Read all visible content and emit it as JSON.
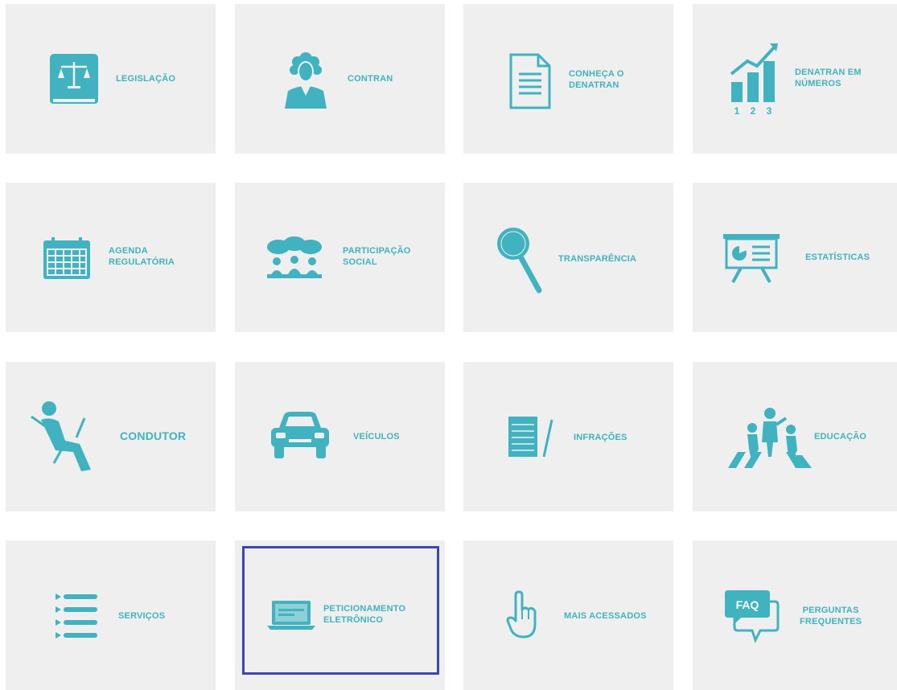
{
  "accent_color": "#41b3c0",
  "tile_background": "#efefef",
  "highlight_color": "#3f46ad",
  "tiles": [
    {
      "label": "LEGISLAÇÃO",
      "icon": "law-book-icon"
    },
    {
      "label": "CONTRAN",
      "icon": "judge-icon"
    },
    {
      "label": "CONHEÇA O\nDENATRAN",
      "icon": "document-icon"
    },
    {
      "label": "DENATRAN EM\nNÚMEROS",
      "icon": "growth-chart-icon",
      "icon_digits": [
        "1",
        "2",
        "3"
      ]
    },
    {
      "label": "AGENDA\nREGULATÓRIA",
      "icon": "calendar-icon"
    },
    {
      "label": "PARTICIPAÇÃO\nSOCIAL",
      "icon": "group-discussion-icon"
    },
    {
      "label": "TRANSPARÊNCIA",
      "icon": "magnifier-icon"
    },
    {
      "label": "ESTATÍSTICAS",
      "icon": "presentation-board-icon"
    },
    {
      "label": "CONDUTOR",
      "icon": "driver-icon"
    },
    {
      "label": "VEÍCULOS",
      "icon": "car-icon"
    },
    {
      "label": "INFRAÇÕES",
      "icon": "notepad-icon"
    },
    {
      "label": "EDUCAÇÃO",
      "icon": "crosswalk-icon"
    },
    {
      "label": "SERVIÇOS",
      "icon": "list-icon"
    },
    {
      "label": "PETICIONAMENTO\nELETRÔNICO",
      "icon": "laptop-icon",
      "selected": true
    },
    {
      "label": "MAIS ACESSADOS",
      "icon": "pointing-hand-icon"
    },
    {
      "label": "PERGUNTAS\nFREQUENTES",
      "icon": "faq-bubble-icon",
      "icon_text": "FAQ"
    }
  ]
}
